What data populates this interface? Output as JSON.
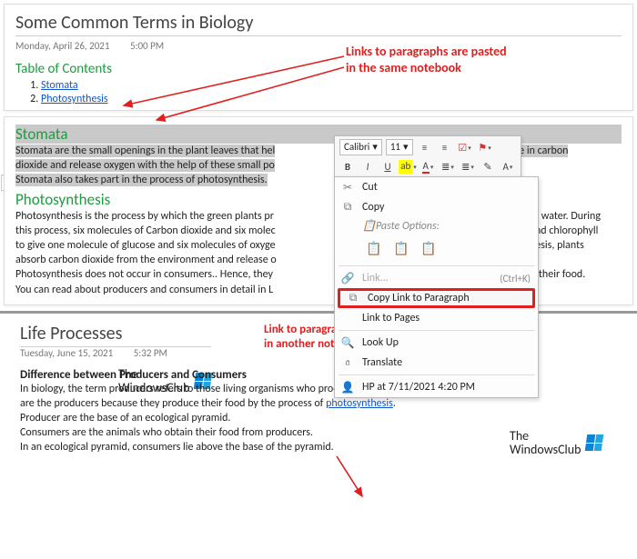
{
  "page1": {
    "title": "Some Common Terms in Biology",
    "date": "Monday, April 26, 2021",
    "time": "5:00 PM",
    "toc_title": "Table of Contents",
    "toc": [
      {
        "label": "Stomata"
      },
      {
        "label": "Photosynthesis"
      }
    ],
    "annotation": "Links to paragraphs are pasted\nin the same notebook",
    "section1": {
      "head": "Stomata",
      "line1": "Stomata are the small openings in the plant leaves that hel",
      "line1b": "The plants take in carbon",
      "line2": "dioxide and release oxygen with the help of these small po",
      "line3": "Stomata also takes part in the process of photosynthesis."
    },
    "section2": {
      "head": "Photosynthesis",
      "l1a": "Photosynthesis is the process by which the green plants pr",
      "l1b": "e of sunlight and water. During",
      "l2a": "this process, six molecules of Carbon dioxide and six molec",
      "l2b": "ence of water and chlorophyll",
      "l3a": "to give one molecule of glucose and six molecules of oxyge",
      "l3b": "s of photosynthesis, plants",
      "l4a": "absorb carbon dioxide from the environment and release o",
      "l5a": "Photosynthesis does not occur in consumers.. Hence, they ",
      "l5b": "ucers) to obtain their food.",
      "l6": "You can read about producers and consumers in detail in L"
    }
  },
  "toolbar": {
    "font": "Calibri",
    "size": "11"
  },
  "ctx": {
    "cut": "Cut",
    "copy": "Copy",
    "pasteopts": "Paste Options:",
    "link": "Link...",
    "link_kb": "(Ctrl+K)",
    "copylink": "Copy Link to Paragraph",
    "linkpages": "Link to Pages",
    "lookup": "Look Up",
    "translate": "Translate",
    "hp": "HP at 7/11/2021 4:20 PM"
  },
  "logo": "The\nWindowsClub",
  "page2": {
    "title": "Life Processes",
    "date": "Tuesday, June 15, 2021",
    "time": "5:32 PM",
    "annotation": "Link to paragraph is pasted\nin another notebook",
    "head": "Difference between Producers and Consumers",
    "l1a": "In biology, the term producers refers to those living organisms who produce food on their own. Plants",
    "l2a": "are the producers because they produce their food by the process of ",
    "l2link": "photosynthesis",
    "l2b": ".",
    "l3": "Producer are the base of an ecological pyramid.",
    "l4": "Consumers are the animals who obtain their food from producers.",
    "l5": "In an ecological pyramid, consumers lie above the base of the pyramid."
  }
}
